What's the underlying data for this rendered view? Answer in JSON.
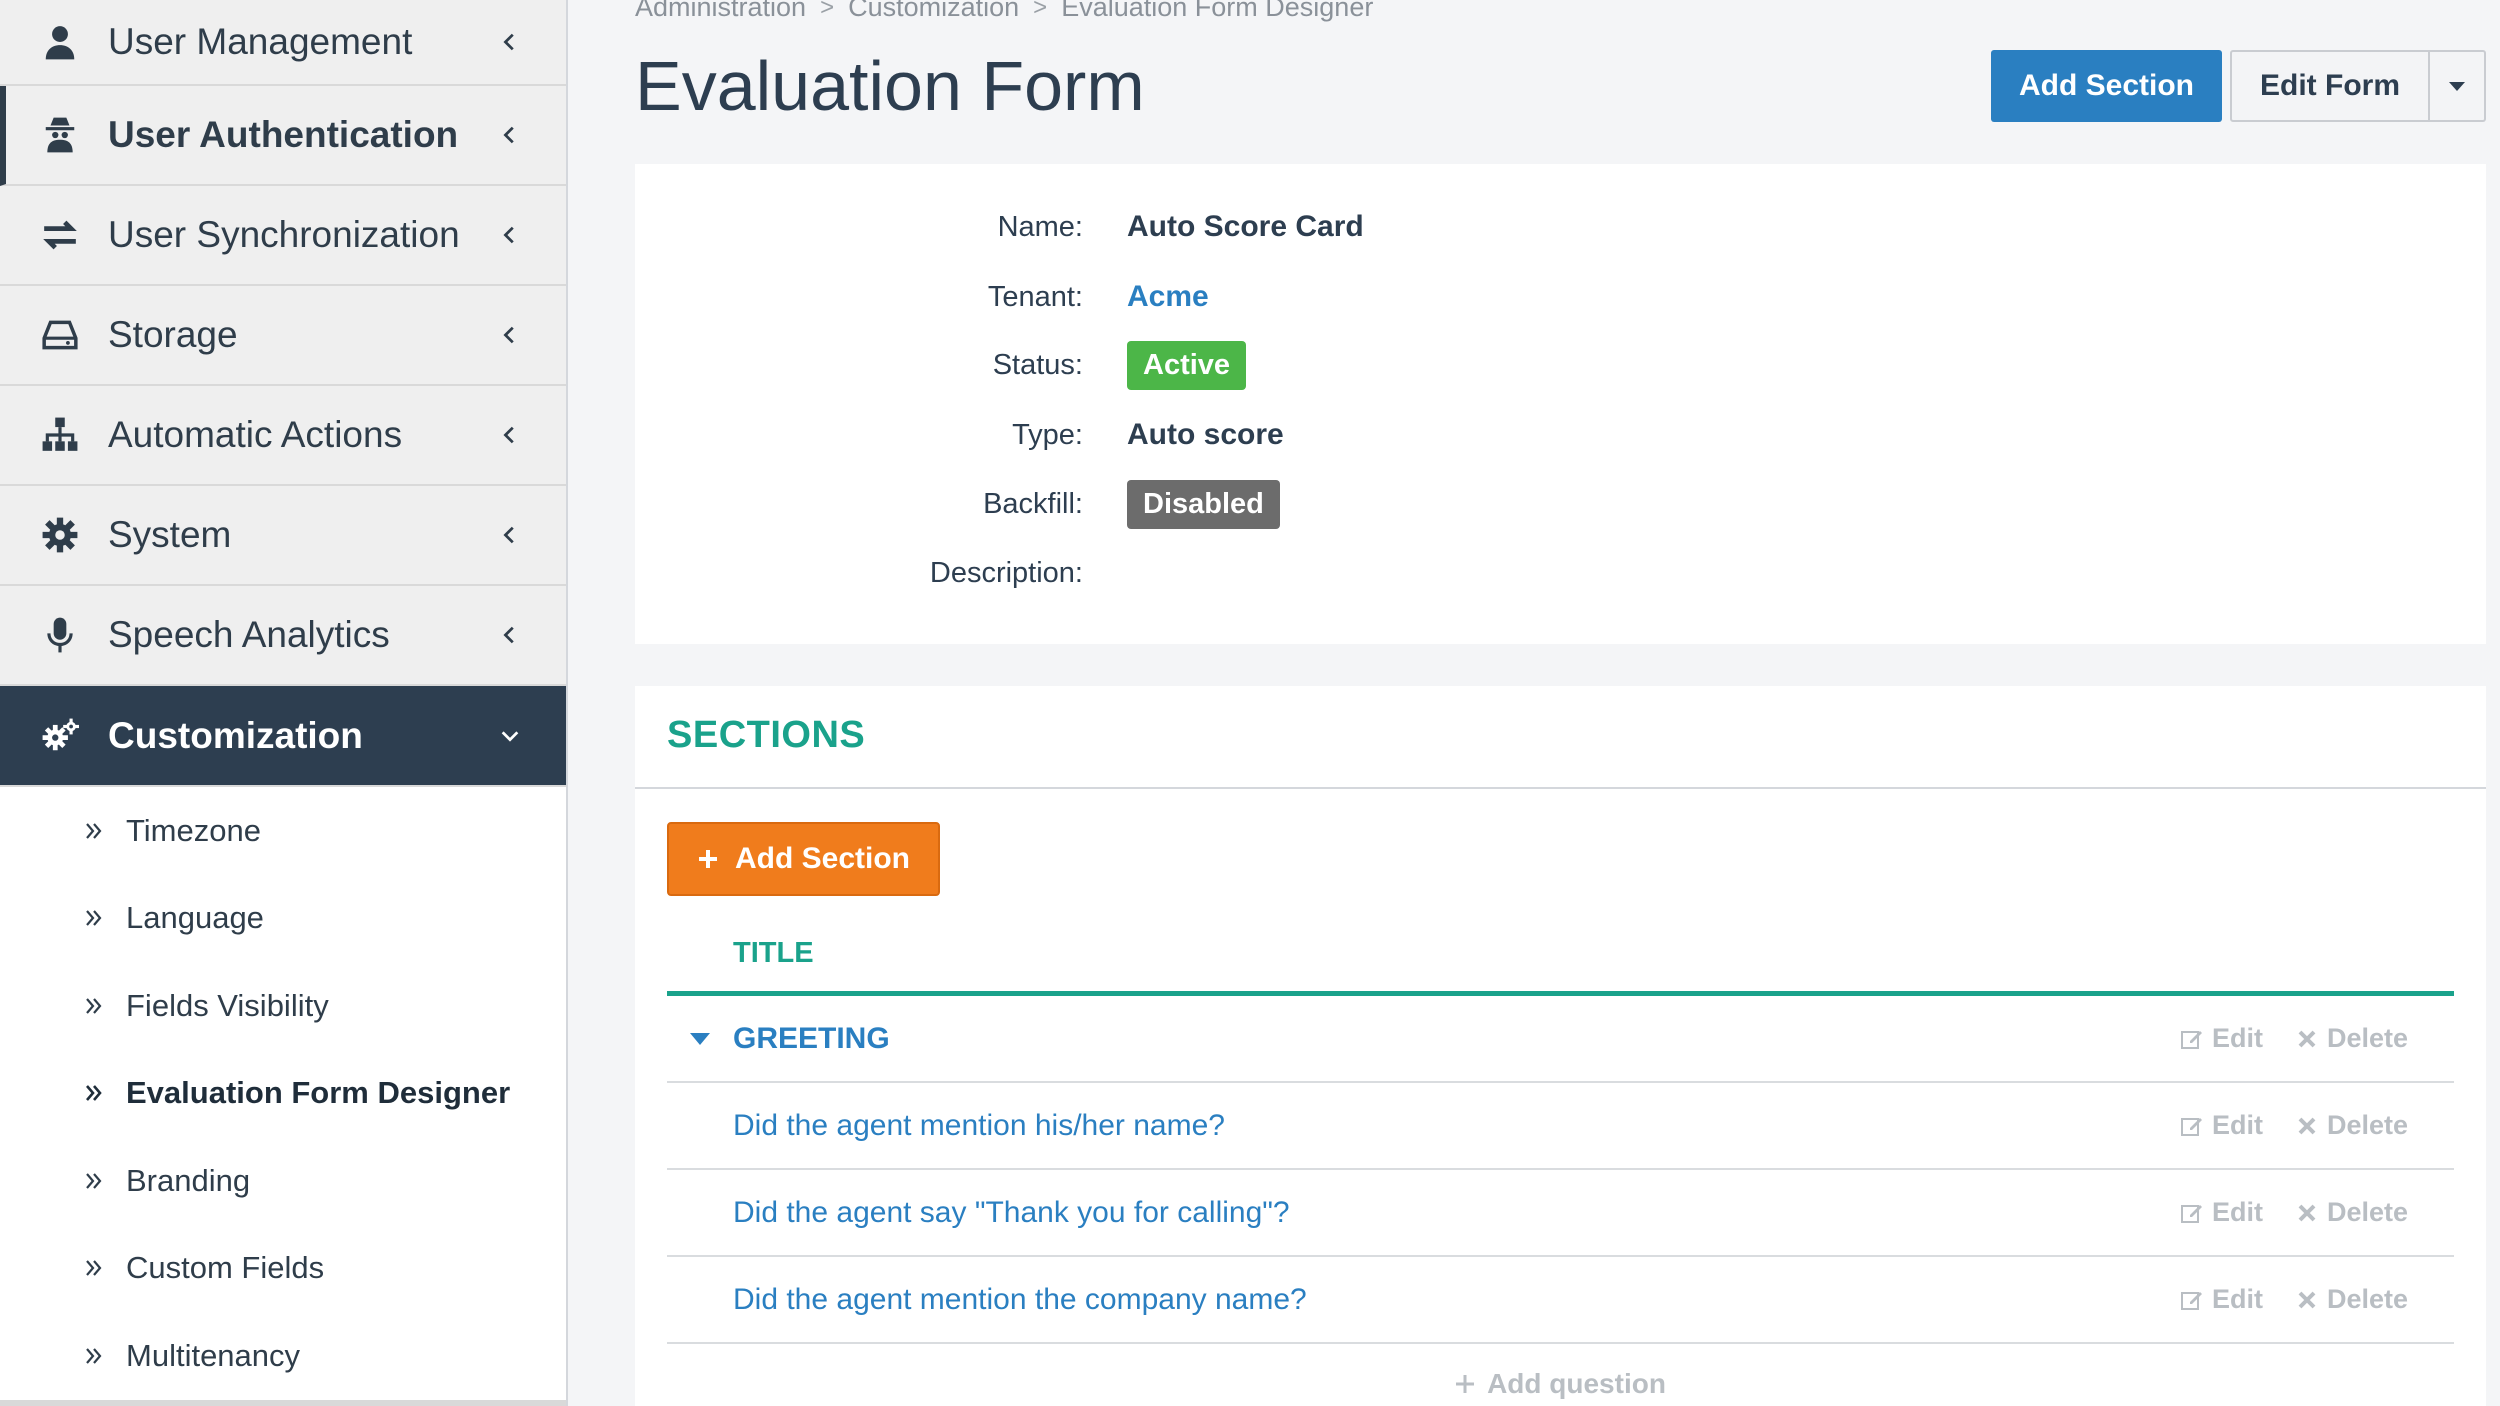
{
  "sidebar": {
    "items": [
      {
        "label": "User Management",
        "icon": "user-icon"
      },
      {
        "label": "User Authentication",
        "icon": "user-secret-icon"
      },
      {
        "label": "User Synchronization",
        "icon": "exchange-icon"
      },
      {
        "label": "Storage",
        "icon": "hdd-icon"
      },
      {
        "label": "Automatic Actions",
        "icon": "sitemap-icon"
      },
      {
        "label": "System",
        "icon": "gear-icon"
      },
      {
        "label": "Speech Analytics",
        "icon": "microphone-icon"
      },
      {
        "label": "Customization",
        "icon": "gears-icon"
      }
    ],
    "sub_items": [
      {
        "label": "Timezone"
      },
      {
        "label": "Language"
      },
      {
        "label": "Fields Visibility"
      },
      {
        "label": "Evaluation Form Designer"
      },
      {
        "label": "Branding"
      },
      {
        "label": "Custom Fields"
      },
      {
        "label": "Multitenancy"
      }
    ]
  },
  "breadcrumb": {
    "items": [
      "Administration",
      "Customization",
      "Evaluation Form Designer"
    ],
    "separator": ">"
  },
  "header": {
    "title": "Evaluation Form",
    "add_section_label": "Add Section",
    "edit_form_label": "Edit Form"
  },
  "info": {
    "name_label": "Name:",
    "name_value": "Auto Score Card",
    "tenant_label": "Tenant:",
    "tenant_value": "Acme",
    "status_label": "Status:",
    "status_value": "Active",
    "type_label": "Type:",
    "type_value": "Auto score",
    "backfill_label": "Backfill:",
    "backfill_value": "Disabled",
    "description_label": "Description:"
  },
  "sections": {
    "title": "SECTIONS",
    "add_section_label": "Add Section",
    "column_title": "TITLE",
    "section_row": {
      "title": "GREETING"
    },
    "questions": [
      {
        "title": "Did the agent mention his/her name?"
      },
      {
        "title": "Did the agent say \"Thank you for calling\"?"
      },
      {
        "title": "Did the agent mention the company name?"
      }
    ],
    "edit_label": "Edit",
    "delete_label": "Delete",
    "add_question_label": "Add question"
  },
  "colors": {
    "primary": "#2a7fc1",
    "sidebar_dark": "#2d3e50",
    "teal": "#1aa28b",
    "orange": "#f07c1c",
    "green": "#4cb648",
    "gray": "#6c6c6c"
  }
}
